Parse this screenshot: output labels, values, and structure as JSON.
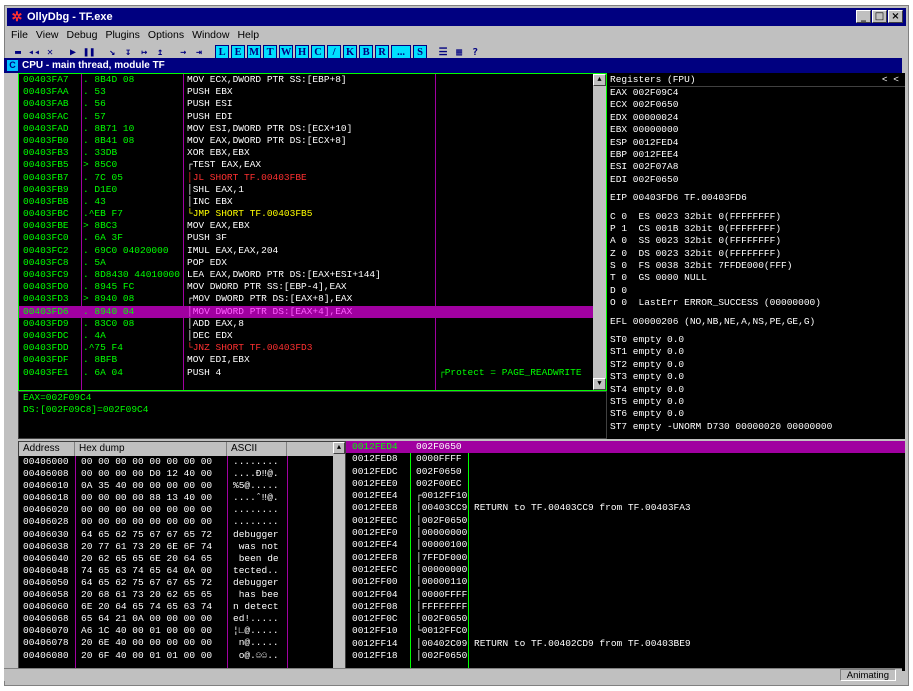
{
  "window": {
    "title": "OllyDbg - TF.exe",
    "btn_min": "_",
    "btn_max": "□",
    "btn_close": "×",
    "app_icon": "bug-icon"
  },
  "menu": [
    "File",
    "View",
    "Debug",
    "Plugins",
    "Options",
    "Window",
    "Help"
  ],
  "toolbar": {
    "controls": [
      "▬",
      "◂◂",
      "✕",
      "▶",
      "❚❚",
      "↘",
      "↧",
      "↦",
      "↥",
      "→",
      "⇥"
    ],
    "letters": [
      "L",
      "E",
      "M",
      "T",
      "W",
      "H",
      "C",
      "/",
      "K",
      "B",
      "R",
      "...",
      "S"
    ],
    "extra": [
      "☰",
      "▦",
      "?"
    ]
  },
  "cpu": {
    "title": "CPU - main thread, module TF",
    "icon": "C"
  },
  "disasm": [
    {
      "addr": "00403FA7",
      "hex": ". 8B4D 08",
      "inst": "MOV ECX,DWORD PTR SS:[EBP+8]",
      "type": ""
    },
    {
      "addr": "00403FAA",
      "hex": ". 53",
      "inst": "PUSH EBX",
      "type": ""
    },
    {
      "addr": "00403FAB",
      "hex": ". 56",
      "inst": "PUSH ESI",
      "type": ""
    },
    {
      "addr": "00403FAC",
      "hex": ". 57",
      "inst": "PUSH EDI",
      "type": ""
    },
    {
      "addr": "00403FAD",
      "hex": ". 8B71 10",
      "inst": "MOV ESI,DWORD PTR DS:[ECX+10]",
      "type": ""
    },
    {
      "addr": "00403FB0",
      "hex": ". 8B41 08",
      "inst": "MOV EAX,DWORD PTR DS:[ECX+8]",
      "type": ""
    },
    {
      "addr": "00403FB3",
      "hex": ". 33DB",
      "inst": "XOR EBX,EBX",
      "type": ""
    },
    {
      "addr": "00403FB5",
      "hex": "> 85C0",
      "inst": "┌TEST EAX,EAX",
      "type": ""
    },
    {
      "addr": "00403FB7",
      "hex": ". 7C 05",
      "inst": "│JL SHORT TF.00403FBE",
      "type": "jcc"
    },
    {
      "addr": "00403FB9",
      "hex": ". D1E0",
      "inst": "│SHL EAX,1",
      "type": ""
    },
    {
      "addr": "00403FBB",
      "hex": ". 43",
      "inst": "│INC EBX",
      "type": ""
    },
    {
      "addr": "00403FBC",
      "hex": ".^EB F7",
      "inst": "└JMP SHORT TF.00403FB5",
      "type": "jmp"
    },
    {
      "addr": "00403FBE",
      "hex": "> 8BC3",
      "inst": "MOV EAX,EBX",
      "type": ""
    },
    {
      "addr": "00403FC0",
      "hex": ". 6A 3F",
      "inst": "PUSH 3F",
      "type": ""
    },
    {
      "addr": "00403FC2",
      "hex": ". 69C0 04020000",
      "inst": "IMUL EAX,EAX,204",
      "type": ""
    },
    {
      "addr": "00403FC8",
      "hex": ". 5A",
      "inst": "POP EDX",
      "type": ""
    },
    {
      "addr": "00403FC9",
      "hex": ". 8D8430 44010000",
      "inst": "LEA EAX,DWORD PTR DS:[EAX+ESI+144]",
      "type": ""
    },
    {
      "addr": "00403FD0",
      "hex": ". 8945 FC",
      "inst": "MOV DWORD PTR SS:[EBP-4],EAX",
      "type": ""
    },
    {
      "addr": "00403FD3",
      "hex": "> 8940 08",
      "inst": "┌MOV DWORD PTR DS:[EAX+8],EAX",
      "type": ""
    },
    {
      "addr": "00403FD6",
      "hex": ". 8940 04",
      "inst": "│MOV DWORD PTR DS:[EAX+4],EAX",
      "type": "sel"
    },
    {
      "addr": "00403FD9",
      "hex": ". 83C0 08",
      "inst": "│ADD EAX,8",
      "type": ""
    },
    {
      "addr": "00403FDC",
      "hex": ". 4A",
      "inst": "│DEC EDX",
      "type": ""
    },
    {
      "addr": "00403FDD",
      "hex": ".^75 F4",
      "inst": "└JNZ SHORT TF.00403FD3",
      "type": "jcc"
    },
    {
      "addr": "00403FDF",
      "hex": ". 8BFB",
      "inst": "MOV EDI,EBX",
      "type": ""
    },
    {
      "addr": "00403FE1",
      "hex": ". 6A 04",
      "inst": "PUSH 4",
      "type": ""
    }
  ],
  "disasm_comment": {
    "row": 24,
    "text": "┌Protect = PAGE_READWRITE"
  },
  "info": [
    "EAX=002F09C4",
    "DS:[002F09C8]=002F09C4"
  ],
  "registers": {
    "header": "Registers (FPU)",
    "nav": "<      <",
    "lines": [
      {
        "t": "EAX 002F09C4",
        "g": false
      },
      {
        "t": "ECX 002F0650",
        "g": false
      },
      {
        "t": "EDX 00000024",
        "g": false
      },
      {
        "t": "EBX 00000000",
        "g": false
      },
      {
        "t": "ESP 0012FED4",
        "g": false
      },
      {
        "t": "EBP 0012FEE4",
        "g": false
      },
      {
        "t": "ESI 002F07A8",
        "g": false
      },
      {
        "t": "EDI 002F0650",
        "g": false
      },
      {
        "t": "EIP 00403FD6 TF.00403FD6",
        "g": true
      },
      {
        "t": "C 0  ES 0023 32bit 0(FFFFFFFF)",
        "g": true
      },
      {
        "t": "P 1  CS 001B 32bit 0(FFFFFFFF)",
        "g": false
      },
      {
        "t": "A 0  SS 0023 32bit 0(FFFFFFFF)",
        "g": false
      },
      {
        "t": "Z 0  DS 0023 32bit 0(FFFFFFFF)",
        "g": false
      },
      {
        "t": "S 0  FS 0038 32bit 7FFDE000(FFF)",
        "g": false
      },
      {
        "t": "T 0  GS 0000 NULL",
        "g": false
      },
      {
        "t": "D 0",
        "g": false
      },
      {
        "t": "O 0  LastErr ERROR_SUCCESS (00000000)",
        "g": false
      },
      {
        "t": "EFL 00000206 (NO,NB,NE,A,NS,PE,GE,G)",
        "g": true
      },
      {
        "t": "ST0 empty 0.0",
        "g": true
      },
      {
        "t": "ST1 empty 0.0",
        "g": false
      },
      {
        "t": "ST2 empty 0.0",
        "g": false
      },
      {
        "t": "ST3 empty 0.0",
        "g": false
      },
      {
        "t": "ST4 empty 0.0",
        "g": false
      },
      {
        "t": "ST5 empty 0.0",
        "g": false
      },
      {
        "t": "ST6 empty 0.0",
        "g": false
      },
      {
        "t": "ST7 empty -UNORM D730 00000020 00000000",
        "g": false
      }
    ]
  },
  "dump": {
    "headers": [
      "Address",
      "Hex dump",
      "ASCII"
    ],
    "rows": [
      {
        "a": "00406000",
        "h": "00 00 00 00 00 00 00 00",
        "s": "........"
      },
      {
        "a": "00406008",
        "h": "00 00 00 00 D0 12 40 00",
        "s": "....Ð‼@."
      },
      {
        "a": "00406010",
        "h": "0A 35 40 00 00 00 00 00",
        "s": "%5@....."
      },
      {
        "a": "00406018",
        "h": "00 00 00 00 88 13 40 00",
        "s": "....ˆ‼@."
      },
      {
        "a": "00406020",
        "h": "00 00 00 00 00 00 00 00",
        "s": "........"
      },
      {
        "a": "00406028",
        "h": "00 00 00 00 00 00 00 00",
        "s": "........"
      },
      {
        "a": "00406030",
        "h": "64 65 62 75 67 67 65 72",
        "s": "debugger"
      },
      {
        "a": "00406038",
        "h": "20 77 61 73 20 6E 6F 74",
        "s": " was not"
      },
      {
        "a": "00406040",
        "h": "20 62 65 65 6E 20 64 65",
        "s": " been de"
      },
      {
        "a": "00406048",
        "h": "74 65 63 74 65 64 0A 00",
        "s": "tected.."
      },
      {
        "a": "00406050",
        "h": "64 65 62 75 67 67 65 72",
        "s": "debugger"
      },
      {
        "a": "00406058",
        "h": "20 68 61 73 20 62 65 65",
        "s": " has bee"
      },
      {
        "a": "00406060",
        "h": "6E 20 64 65 74 65 63 74",
        "s": "n detect"
      },
      {
        "a": "00406068",
        "h": "65 64 21 0A 00 00 00 00",
        "s": "ed!....."
      },
      {
        "a": "00406070",
        "h": "A6 1C 40 00 01 00 00 00",
        "s": "¦∟@....."
      },
      {
        "a": "00406078",
        "h": "20 6E 40 00 00 00 00 00",
        "s": " n@....."
      },
      {
        "a": "00406080",
        "h": "20 6F 40 00 01 01 00 00",
        "s": " o@.☺☺.."
      }
    ]
  },
  "stack": [
    {
      "a": "0012FED4",
      "v": "002F0650",
      "c": ""
    },
    {
      "a": "0012FED8",
      "v": "0000FFFF",
      "c": ""
    },
    {
      "a": "0012FEDC",
      "v": "002F0650",
      "c": ""
    },
    {
      "a": "0012FEE0",
      "v": "002F00EC",
      "c": ""
    },
    {
      "a": "0012FEE4",
      "v": "┌0012FF10",
      "c": ""
    },
    {
      "a": "0012FEE8",
      "v": "│00403CC9",
      "c": "RETURN to TF.00403CC9 from TF.00403FA3"
    },
    {
      "a": "0012FEEC",
      "v": "│002F0650",
      "c": ""
    },
    {
      "a": "0012FEF0",
      "v": "│00000000",
      "c": ""
    },
    {
      "a": "0012FEF4",
      "v": "│00000100",
      "c": ""
    },
    {
      "a": "0012FEF8",
      "v": "│7FFDF000",
      "c": ""
    },
    {
      "a": "0012FEFC",
      "v": "│00000000",
      "c": ""
    },
    {
      "a": "0012FF00",
      "v": "│00000110",
      "c": ""
    },
    {
      "a": "0012FF04",
      "v": "│0000FFFF",
      "c": ""
    },
    {
      "a": "0012FF08",
      "v": "│FFFFFFFF",
      "c": ""
    },
    {
      "a": "0012FF0C",
      "v": "│002F0650",
      "c": ""
    },
    {
      "a": "0012FF10",
      "v": "└0012FFC0",
      "c": ""
    },
    {
      "a": "0012FF14",
      "v": "│00402C09",
      "c": "RETURN to TF.00402CD9 from TF.00403BE9"
    },
    {
      "a": "0012FF18",
      "v": "│002F0650",
      "c": ""
    }
  ],
  "status": "Animating"
}
